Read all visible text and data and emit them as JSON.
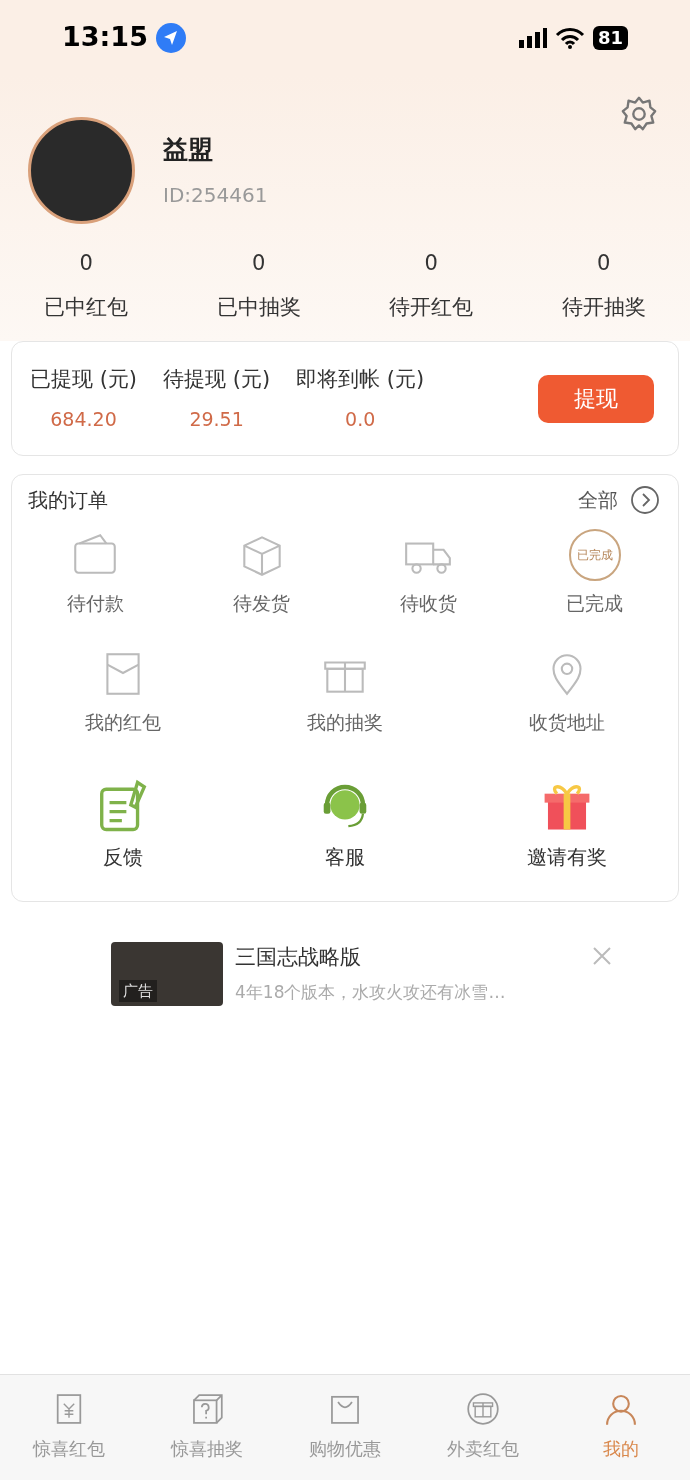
{
  "status_bar": {
    "time": "13:15",
    "battery": "81"
  },
  "profile": {
    "name": "益盟",
    "id": "ID:254461"
  },
  "stats": [
    {
      "value": "0",
      "label": "已中红包"
    },
    {
      "value": "0",
      "label": "已中抽奖"
    },
    {
      "value": "0",
      "label": "待开红包"
    },
    {
      "value": "0",
      "label": "待开抽奖"
    }
  ],
  "balance": {
    "items": [
      {
        "label": "已提现 (元)",
        "value": "684.20"
      },
      {
        "label": "待提现 (元)",
        "value": "29.51"
      },
      {
        "label": "即将到帐 (元)",
        "value": "0.0"
      }
    ],
    "button": "提现"
  },
  "orders": {
    "title": "我的订单",
    "more": "全部",
    "statuses": [
      {
        "kind": "pay",
        "label": "待付款"
      },
      {
        "kind": "ship",
        "label": "待发货"
      },
      {
        "kind": "receive",
        "label": "待收货"
      },
      {
        "kind": "done",
        "label": "已完成",
        "stamp": "已完成"
      }
    ]
  },
  "shortcuts": [
    {
      "kind": "redpacket",
      "label": "我的红包"
    },
    {
      "kind": "lottery",
      "label": "我的抽奖"
    },
    {
      "kind": "address",
      "label": "收货地址"
    }
  ],
  "services": [
    {
      "kind": "feedback",
      "label": "反馈"
    },
    {
      "kind": "support",
      "label": "客服"
    },
    {
      "kind": "gift",
      "label": "邀请有奖"
    }
  ],
  "ad": {
    "title": "三国志战略版",
    "description": "4年18个版本，水攻火攻还有冰雪…",
    "tag": "广告"
  },
  "tab_bar": [
    {
      "kind": "redpacket",
      "label": "惊喜红包",
      "selected": false
    },
    {
      "kind": "lottery",
      "label": "惊喜抽奖",
      "selected": false
    },
    {
      "kind": "bag",
      "label": "购物优惠",
      "selected": false
    },
    {
      "kind": "gift",
      "label": "外卖红包",
      "selected": false
    },
    {
      "kind": "user",
      "label": "我的",
      "selected": true
    }
  ]
}
